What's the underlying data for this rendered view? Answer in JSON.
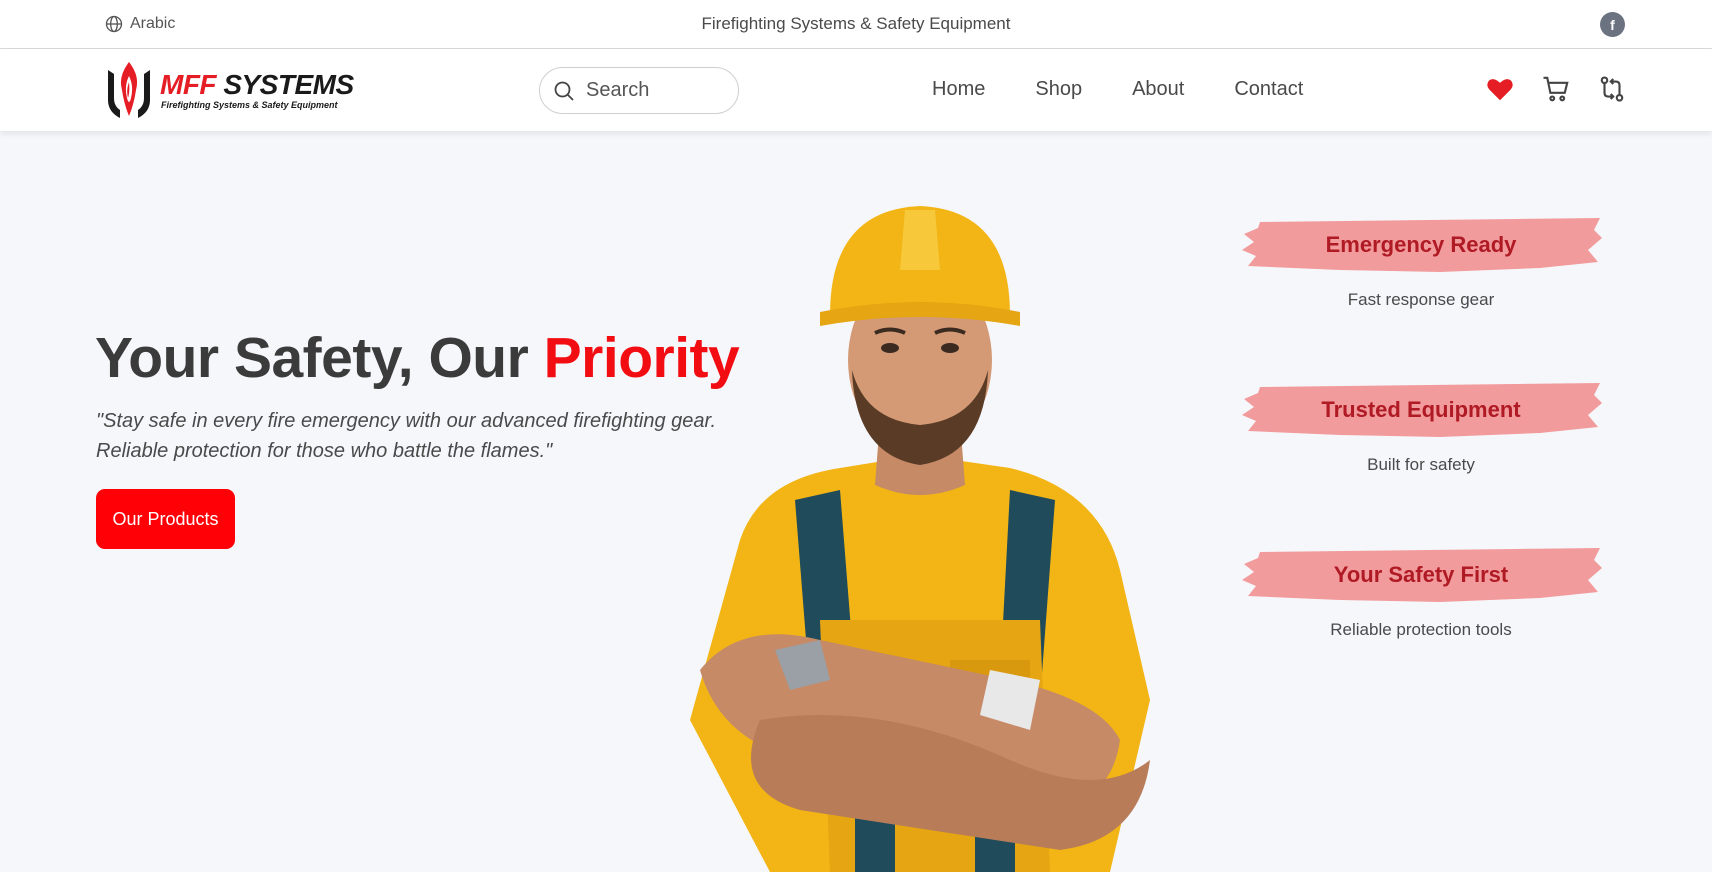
{
  "topbar": {
    "language": "Arabic",
    "tagline": "Firefighting Systems & Safety Equipment",
    "social_icon": "facebook-icon"
  },
  "header": {
    "logo_name_red": "MFF",
    "logo_name_rest": "SYSTEMS",
    "logo_sub": "Firefighting Systems & Safety Equipment",
    "search_placeholder": "Search",
    "nav": [
      "Home",
      "Shop",
      "About",
      "Contact"
    ],
    "icons": [
      "heart-icon",
      "cart-icon",
      "compare-icon"
    ]
  },
  "hero": {
    "title_main": "Your Safety, Our ",
    "title_accent": "Priority",
    "quote_line1": "\"Stay safe in every fire emergency with our advanced firefighting gear.",
    "quote_line2": "Reliable protection for those who battle the flames.\"",
    "cta_label": "Our Products"
  },
  "features": [
    {
      "title": "Emergency Ready",
      "desc": "Fast response gear"
    },
    {
      "title": "Trusted Equipment",
      "desc": "Built for safety"
    },
    {
      "title": "Your Safety First",
      "desc": "Reliable protection tools"
    }
  ],
  "colors": {
    "accent": "#fe0006",
    "brush": "#f29b9c",
    "feature_title": "#b01a24",
    "heart": "#e51d24"
  }
}
